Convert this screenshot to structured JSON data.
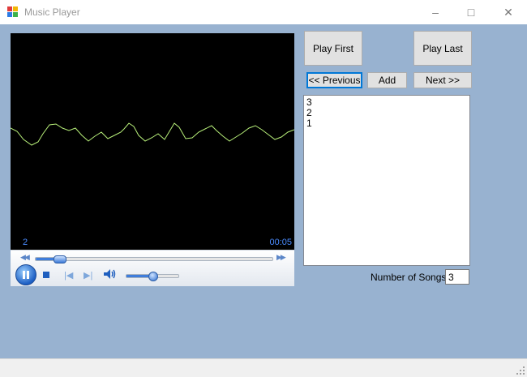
{
  "window": {
    "title": "Music Player",
    "minimize_glyph": "–",
    "maximize_glyph": "□",
    "close_glyph": "✕"
  },
  "player": {
    "track_number": "2",
    "elapsed_time": "00:05",
    "seek_position": 0.1,
    "volume_level": 0.5,
    "state": "playing",
    "accent_color": "#4a8cff",
    "visualizer_color": "#b8f07a",
    "icons": {
      "play_pause": "pause-icon",
      "stop": "stop-icon",
      "previous": "skip-previous-icon",
      "next": "skip-next-icon",
      "volume": "speaker-icon"
    }
  },
  "buttons": {
    "play_first": "Play First",
    "play_last": "Play Last",
    "previous": "<< Previous",
    "add": "Add",
    "next": "Next >>"
  },
  "playlist": {
    "items": [
      "3",
      "2",
      "1"
    ]
  },
  "song_count": {
    "label": "Number of Songs",
    "value": "3"
  },
  "colors": {
    "client_background": "#98b2d0",
    "focus_border": "#0078d7"
  }
}
